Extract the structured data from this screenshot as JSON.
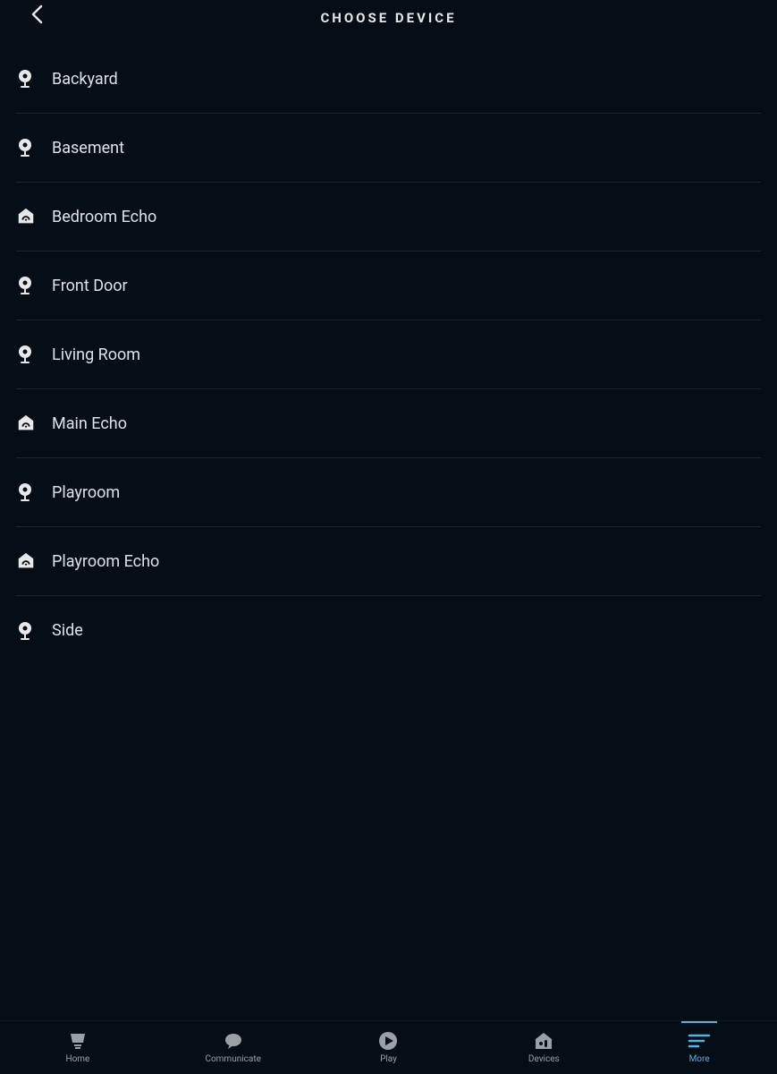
{
  "header": {
    "title": "CHOOSE DEVICE"
  },
  "devices": [
    {
      "icon": "camera",
      "label": "Backyard"
    },
    {
      "icon": "camera",
      "label": "Basement"
    },
    {
      "icon": "echo",
      "label": "Bedroom Echo"
    },
    {
      "icon": "camera",
      "label": "Front Door"
    },
    {
      "icon": "camera",
      "label": "Living Room"
    },
    {
      "icon": "echo",
      "label": "Main Echo"
    },
    {
      "icon": "camera",
      "label": "Playroom"
    },
    {
      "icon": "echo",
      "label": "Playroom Echo"
    },
    {
      "icon": "camera",
      "label": "Side"
    }
  ],
  "tabs": [
    {
      "id": "home",
      "label": "Home",
      "active": false
    },
    {
      "id": "communicate",
      "label": "Communicate",
      "active": false
    },
    {
      "id": "play",
      "label": "Play",
      "active": false
    },
    {
      "id": "devices",
      "label": "Devices",
      "active": false
    },
    {
      "id": "more",
      "label": "More",
      "active": true
    }
  ]
}
